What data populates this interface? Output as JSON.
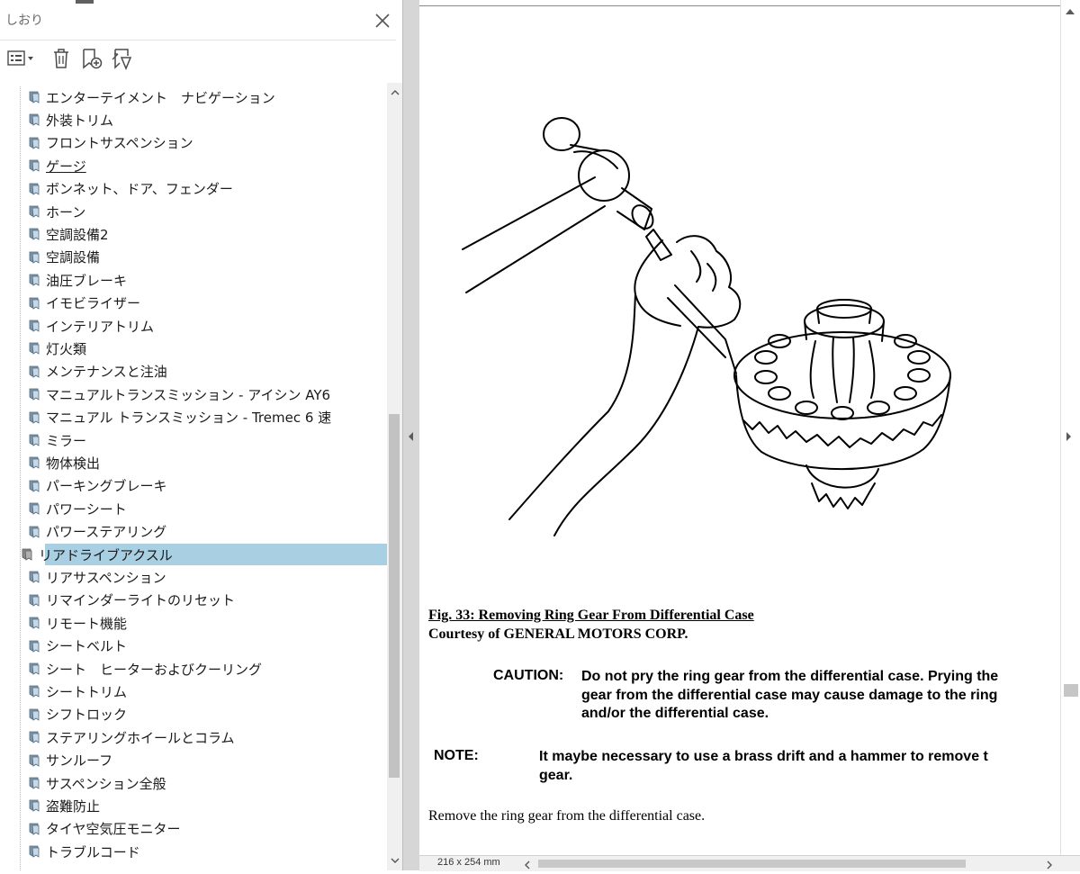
{
  "panel": {
    "title": "しおり",
    "toolbar": {
      "options_icon": "list-options-icon",
      "delete_icon": "trash-icon",
      "add_icon": "bookmark-add-icon",
      "find_icon": "bookmark-find-icon"
    }
  },
  "bookmarks": [
    {
      "label": "エンターテイメント　ナビゲーション"
    },
    {
      "label": "外装トリム"
    },
    {
      "label": "フロントサスペンション"
    },
    {
      "label": "ゲージ"
    },
    {
      "label": "ボンネット、ドア、フェンダー"
    },
    {
      "label": "ホーン"
    },
    {
      "label": "空調設備2"
    },
    {
      "label": "空調設備"
    },
    {
      "label": "油圧ブレーキ"
    },
    {
      "label": "イモビライザー"
    },
    {
      "label": "インテリアトリム"
    },
    {
      "label": "灯火類"
    },
    {
      "label": "メンテナンスと注油"
    },
    {
      "label": "マニュアルトランスミッション - アイシン AY6"
    },
    {
      "label": "マニュアル トランスミッション - Tremec 6 速"
    },
    {
      "label": "ミラー"
    },
    {
      "label": "物体検出"
    },
    {
      "label": "パーキングブレーキ"
    },
    {
      "label": "パワーシート"
    },
    {
      "label": "パワーステアリング"
    },
    {
      "label": "リアドライブアクスル"
    },
    {
      "label": "リアサスペンション"
    },
    {
      "label": "リマインダーライトのリセット"
    },
    {
      "label": "リモート機能"
    },
    {
      "label": "シートベルト"
    },
    {
      "label": "シート　ヒーターおよびクーリング"
    },
    {
      "label": "シートトリム"
    },
    {
      "label": "シフトロック"
    },
    {
      "label": "ステアリングホイールとコラム"
    },
    {
      "label": "サンルーフ"
    },
    {
      "label": "サスペンション全般"
    },
    {
      "label": "盗難防止"
    },
    {
      "label": "タイヤ空気圧モニター"
    },
    {
      "label": "トラブルコード"
    }
  ],
  "selected_bookmark": "リアドライブアクスル",
  "underlined_bookmark": "ゲージ",
  "document": {
    "figure_caption": "Fig. 33: Removing Ring Gear From Differential Case",
    "courtesy": "Courtesy of GENERAL MOTORS CORP.",
    "caution_label": "CAUTION:",
    "caution_lines": [
      "Do not pry the ring gear from the differential case. Prying the",
      "gear from the differential case may cause damage to the ring",
      "and/or the differential case."
    ],
    "note_label": "NOTE:",
    "note_lines": [
      "It maybe necessary to use a brass drift and a hammer to remove t",
      "gear."
    ],
    "body": "Remove the ring gear from the differential case."
  },
  "statusbar": {
    "page_size": "216 x 254 mm"
  },
  "colors": {
    "selection": "#a9cfe3",
    "splitter": "#d6d6d6"
  }
}
